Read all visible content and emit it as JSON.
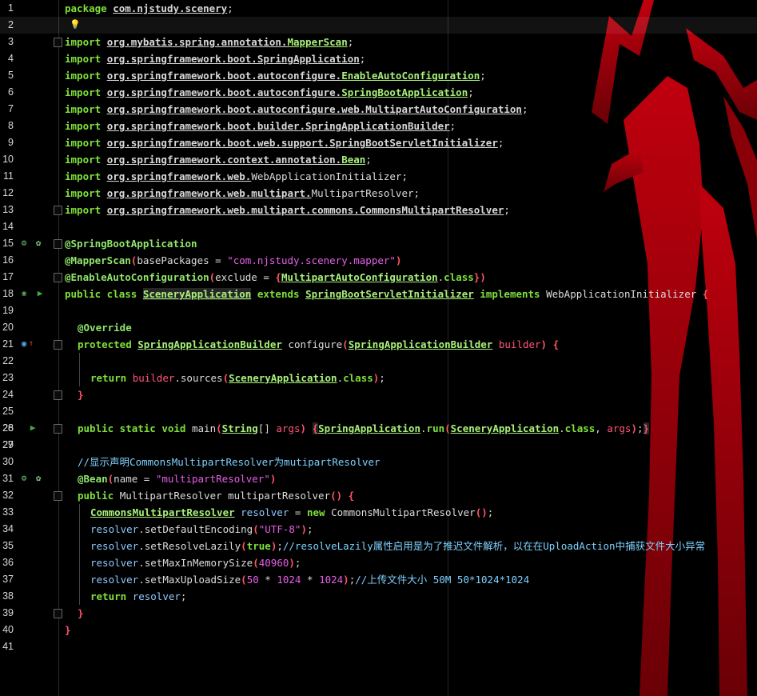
{
  "gutter": {
    "line_numbers": [
      "1",
      "2",
      "3",
      "4",
      "5",
      "6",
      "7",
      "8",
      "9",
      "10",
      "11",
      "12",
      "13",
      "14",
      "15",
      "16",
      "17",
      "18",
      "19",
      "20",
      "21",
      "22",
      "23",
      "24",
      "25",
      "26",
      "27",
      "28",
      "29",
      "30",
      "31",
      "32",
      "33",
      "34",
      "35",
      "36",
      "37",
      "38",
      "39",
      "40",
      "41"
    ]
  },
  "code": {
    "l1": {
      "kw": "package",
      "pkg": "com.njstudy.scenery",
      ";": ";"
    },
    "l3": {
      "kw": "import",
      "pkg": "org.mybatis.spring.annotation.",
      "cls": "MapperScan"
    },
    "l4": {
      "kw": "import",
      "pkg": "org.springframework.boot.SpringApplication"
    },
    "l5": {
      "kw": "import",
      "pkg": "org.springframework.boot.autoconfigure.",
      "cls": "EnableAutoConfiguration"
    },
    "l6": {
      "kw": "import",
      "pkg": "org.springframework.boot.autoconfigure.",
      "cls": "SpringBootApplication"
    },
    "l7": {
      "kw": "import",
      "pkg": "org.springframework.boot.autoconfigure.web.MultipartAutoConfiguration"
    },
    "l8": {
      "kw": "import",
      "pkg": "org.springframework.boot.builder.SpringApplicationBuilder"
    },
    "l9": {
      "kw": "import",
      "pkg": "org.springframework.boot.web.support.SpringBootServletInitializer"
    },
    "l10": {
      "kw": "import",
      "pkg": "org.springframework.context.annotation.",
      "cls": "Bean"
    },
    "l11": {
      "kw": "import",
      "pkg": "org.springframework.web.",
      "cls": "WebApplicationInitializer"
    },
    "l12": {
      "kw": "import",
      "pkg": "org.springframework.web.multipart.",
      "cls": "MultipartResolver"
    },
    "l13": {
      "kw": "import",
      "pkg": "org.springframework.web.multipart.commons.CommonsMultipartResolver"
    },
    "l15": {
      "ann": "@SpringBootApplication"
    },
    "l16": {
      "ann": "@MapperScan",
      "attr": "basePackages",
      "str": "\"com.njstudy.scenery.mapper\""
    },
    "l17": {
      "ann": "@EnableAutoConfiguration",
      "attr": "exclude",
      "cls": "MultipartAutoConfiguration",
      "kw": "class"
    },
    "l18": {
      "kw1": "public class",
      "cls": "SceneryApplication",
      "kw2": "extends",
      "sup": "SpringBootServletInitializer",
      "kw3": "implements",
      "iface": "WebApplicationInitializer"
    },
    "l20": {
      "ann": "@Override"
    },
    "l21": {
      "kw": "protected",
      "type": "SpringApplicationBuilder",
      "name": "configure",
      "ptype": "SpringApplicationBuilder",
      "param": "builder"
    },
    "l23": {
      "kw": "return",
      "var": "builder",
      "method": "sources",
      "cls": "SceneryApplication",
      "kw2": "class"
    },
    "l26": {
      "kw": "public static void",
      "name": "main",
      "type": "String",
      "param": "args",
      "cls": "SpringApplication",
      "method": "run",
      "cls2": "SceneryApplication",
      "kw2": "class",
      "arg": "args"
    },
    "l30": {
      "cmt": "//显示声明CommonsMultipartResolver为mutipartResolver"
    },
    "l31": {
      "ann": "@Bean",
      "attr": "name",
      "str": "\"multipartResolver\""
    },
    "l32": {
      "kw": "public",
      "type": "MultipartResolver",
      "name": "multipartResolver"
    },
    "l33": {
      "type": "CommonsMultipartResolver",
      "var": "resolver",
      "kw": "new",
      "ctor": "CommonsMultipartResolver"
    },
    "l34": {
      "var": "resolver",
      "method": "setDefaultEncoding",
      "str": "\"UTF-8\""
    },
    "l35": {
      "var": "resolver",
      "method": "setResolveLazily",
      "kw": "true",
      "cmt": "//resolveLazily属性启用是为了推迟文件解析，以在在UploadAction中捕获文件大小异常"
    },
    "l36": {
      "var": "resolver",
      "method": "setMaxInMemorySize",
      "num": "40960"
    },
    "l37": {
      "var": "resolver",
      "method": "setMaxUploadSize",
      "n1": "50",
      "op": "*",
      "n2": "1024",
      "n3": "1024",
      "cmt": "//上传文件大小 50M 50*1024*1024"
    },
    "l38": {
      "kw": "return",
      "var": "resolver"
    }
  },
  "icons": {
    "intention": "lightbulb-icon",
    "spring_bean": "spring-bean-icon",
    "run": "run-gutter-icon",
    "override": "override-icon",
    "fold": "fold-icon"
  },
  "colors": {
    "background": "#000000",
    "keyword": "#7ee03a",
    "string": "#e75ee8",
    "comment": "#7ed2ff",
    "paren": "#ff5566",
    "spider_red": "#b3000c"
  }
}
